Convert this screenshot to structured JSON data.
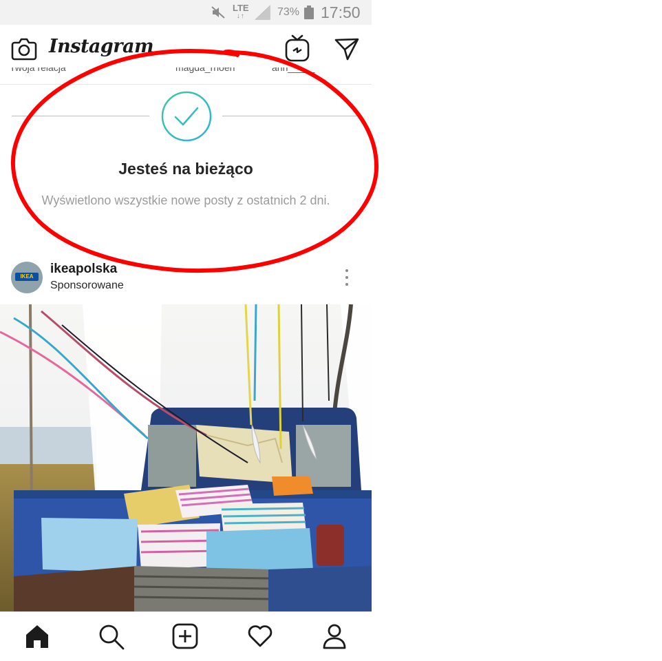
{
  "status_bar": {
    "network": "LTE",
    "battery_percent": "73%",
    "time": "17:50",
    "icons": [
      "mute-icon",
      "signal-icon",
      "battery-icon"
    ]
  },
  "header": {
    "app_name": "Instagram",
    "icons": [
      "camera-icon",
      "igtv-icon",
      "direct-message-icon"
    ]
  },
  "stories_remnant": [
    "Twoja relacja",
    "magda_rhoen",
    "ann_____"
  ],
  "caught_up": {
    "title": "Jesteś na bieżąco",
    "subtitle": "Wyświetlono wszystkie nowe posty z ostatnich 2 dni.",
    "icon": "checkmark-circle-icon",
    "accent_colors": [
      "#3ec7a0",
      "#2ab4d8"
    ]
  },
  "post": {
    "username": "ikeapolska",
    "label": "Sponsorowane",
    "avatar_text": "IKEA",
    "menu_icon": "more-vertical-icon",
    "image": "pickup-truck-bed-with-pillows-and-ribbons"
  },
  "bottom_nav": {
    "items": [
      "home-icon",
      "search-icon",
      "add-post-icon",
      "activity-heart-icon",
      "profile-icon"
    ]
  },
  "annotation": {
    "color": "#ff0000",
    "shape": "hand-drawn-circle"
  }
}
